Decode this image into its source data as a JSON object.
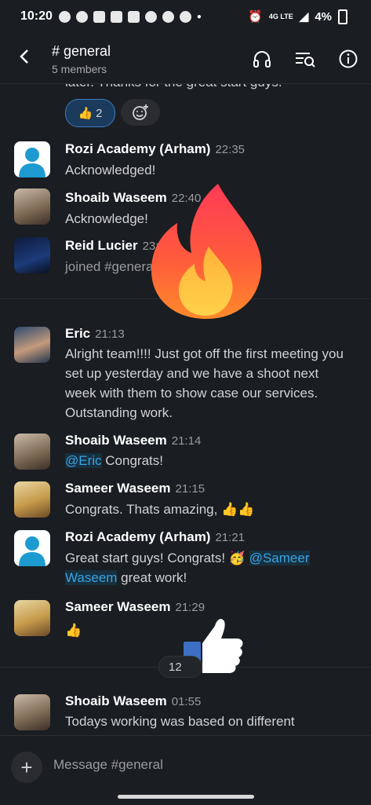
{
  "status_bar": {
    "time": "10:20",
    "network": "4G LTE",
    "battery": "4%"
  },
  "header": {
    "back_icon": "←",
    "title": "# general",
    "subtitle": "5 members"
  },
  "partial_message": {
    "text": "later. Thanks for the great start guys."
  },
  "reactions": {
    "thumbs_emoji": "👍",
    "thumbs_count": "2",
    "add_reaction_icon": "add-reaction-icon"
  },
  "messages": [
    {
      "name": "Rozi Academy (Arham)",
      "time": "22:35",
      "text": "Acknowledged!"
    },
    {
      "name": "Shoaib Waseem",
      "time": "22:40",
      "text": "Acknowledge!"
    },
    {
      "name": "Reid Lucier",
      "time": "23:52",
      "text": "joined #general."
    },
    {
      "name": "Eric",
      "time": "21:13",
      "text": "Alright team!!!! Just got off the first meeting you set up yesterday and we have a shoot next week with them to show case our services. Outstanding work."
    },
    {
      "name": "Shoaib Waseem",
      "time": "21:14",
      "mention": "@Eric",
      "text": " Congrats!"
    },
    {
      "name": "Sameer Waseem",
      "time": "21:15",
      "text": "Congrats. Thats amazing, 👍👍"
    },
    {
      "name": "Rozi Academy (Arham)",
      "time": "21:21",
      "text_before": "Great start guys! Congrats! 🥳 ",
      "mention": "@Sameer Waseem",
      "text_after": " great work!"
    },
    {
      "name": "Sameer Waseem",
      "time": "21:29",
      "text": "👍"
    },
    {
      "name": "Shoaib Waseem",
      "time": "01:55",
      "text": "Todays working was based on different"
    }
  ],
  "new_count_badge": "12",
  "composer": {
    "placeholder": "Message #general",
    "add_icon": "+"
  }
}
